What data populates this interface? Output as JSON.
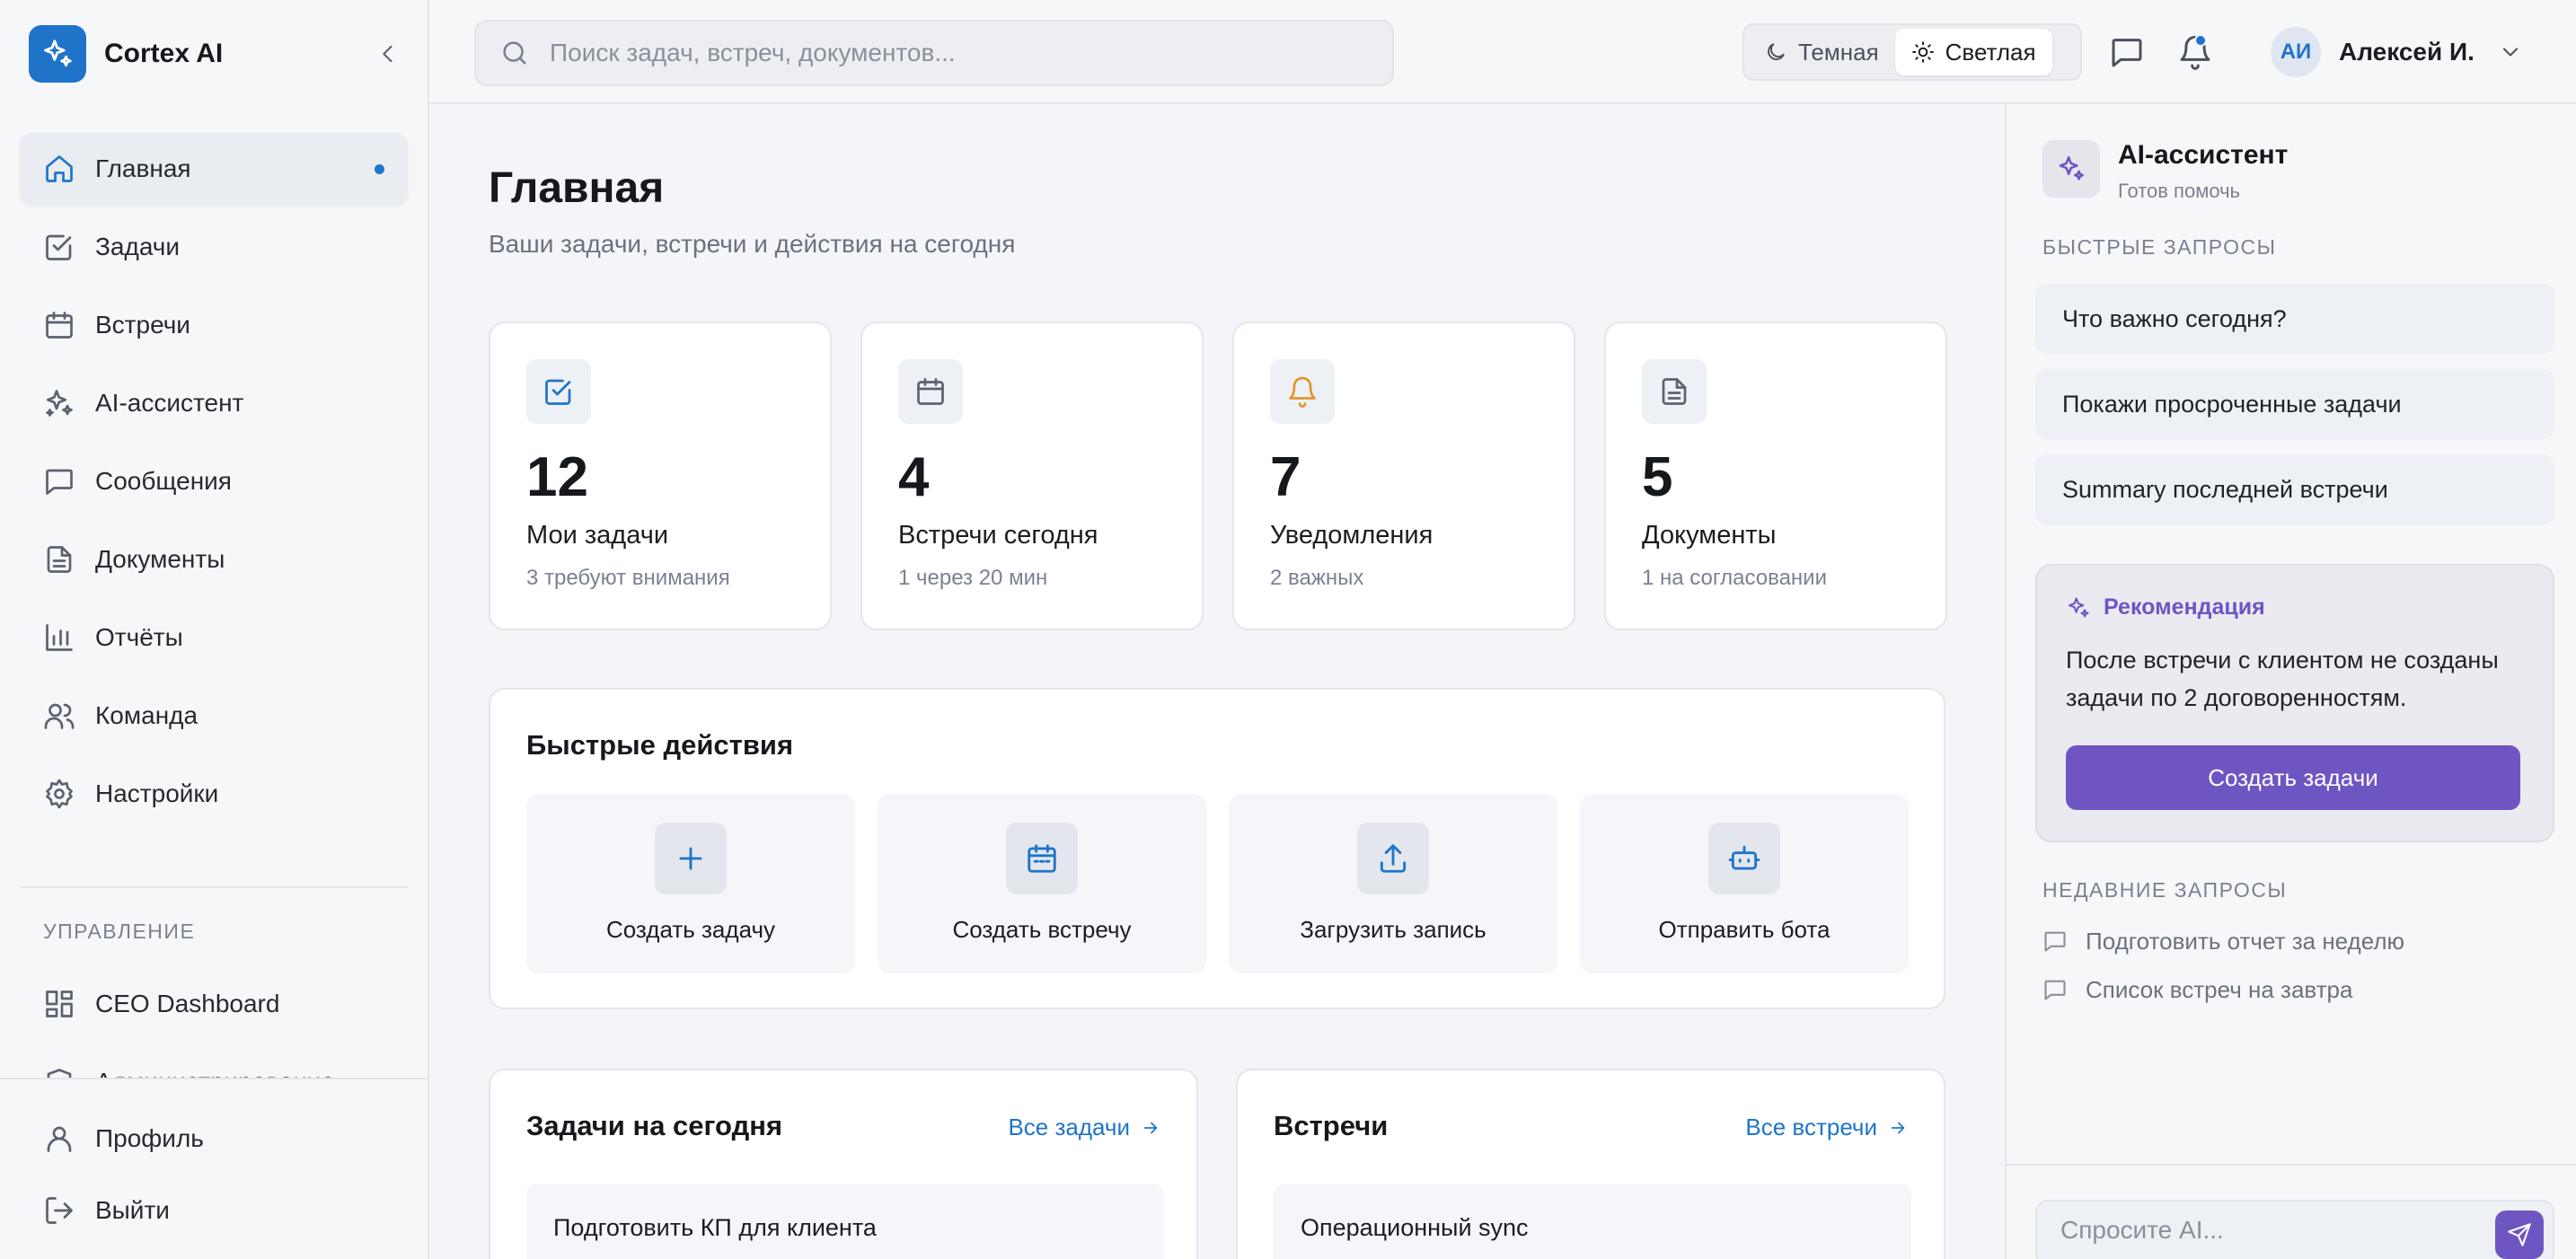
{
  "brand": {
    "name": "Cortex AI"
  },
  "sidebar": {
    "items": [
      {
        "label": "Главная",
        "icon": "home-icon",
        "active": true
      },
      {
        "label": "Задачи",
        "icon": "check-square-icon"
      },
      {
        "label": "Встречи",
        "icon": "calendar-icon"
      },
      {
        "label": "AI-ассистент",
        "icon": "sparkles-icon"
      },
      {
        "label": "Сообщения",
        "icon": "message-icon"
      },
      {
        "label": "Документы",
        "icon": "document-icon"
      },
      {
        "label": "Отчёты",
        "icon": "bar-chart-icon"
      },
      {
        "label": "Команда",
        "icon": "users-icon"
      },
      {
        "label": "Настройки",
        "icon": "gear-icon"
      }
    ],
    "section_label": "УПРАВЛЕНИЕ",
    "manage_items": [
      {
        "label": "CEO Dashboard",
        "icon": "dashboard-icon"
      },
      {
        "label": "Администрирование",
        "icon": "shield-icon"
      }
    ],
    "bottom_items": [
      {
        "label": "Профиль",
        "icon": "user-icon"
      },
      {
        "label": "Выйти",
        "icon": "logout-icon"
      }
    ]
  },
  "topbar": {
    "search_placeholder": "Поиск задач, встреч, документов...",
    "theme_dark": "Темная",
    "theme_light": "Светлая",
    "user_initials": "АИ",
    "user_name": "Алексей И."
  },
  "main": {
    "title": "Главная",
    "subtitle": "Ваши задачи, встречи и действия на сегодня",
    "stats": [
      {
        "value": "12",
        "label": "Мои задачи",
        "sub": "3 требуют внимания",
        "icon": "check-square-icon",
        "icon_color": "#1f74c9"
      },
      {
        "value": "4",
        "label": "Встречи сегодня",
        "sub": "1 через 20 мин",
        "icon": "calendar-icon",
        "icon_color": "#5b6270"
      },
      {
        "value": "7",
        "label": "Уведомления",
        "sub": "2 важных",
        "icon": "bell-icon",
        "icon_color": "#e0962a"
      },
      {
        "value": "5",
        "label": "Документы",
        "sub": "1 на согласовании",
        "icon": "document-icon",
        "icon_color": "#5b6270"
      }
    ],
    "quick_actions": {
      "title": "Быстрые действия",
      "items": [
        {
          "label": "Создать задачу",
          "icon": "plus-icon"
        },
        {
          "label": "Создать встречу",
          "icon": "calendar-icon"
        },
        {
          "label": "Загрузить запись",
          "icon": "upload-icon"
        },
        {
          "label": "Отправить бота",
          "icon": "bot-icon"
        }
      ]
    },
    "tasks": {
      "title": "Задачи на сегодня",
      "link": "Все задачи",
      "first_item": "Подготовить КП для клиента"
    },
    "meetings": {
      "title": "Встречи",
      "link": "Все встречи",
      "first_item": "Операционный sync"
    }
  },
  "assistant": {
    "title": "AI-ассистент",
    "status": "Готов помочь",
    "quick_label": "БЫСТРЫЕ ЗАПРОСЫ",
    "quick_prompts": [
      "Что важно сегодня?",
      "Покажи просроченные задачи",
      "Summary последней встречи"
    ],
    "recommendation": {
      "title": "Рекомендация",
      "text": "После встречи с клиентом не созданы задачи по 2 договоренностям.",
      "button": "Создать задачи"
    },
    "recent_label": "НЕДАВНИЕ ЗАПРОСЫ",
    "recent": [
      "Подготовить отчет за неделю",
      "Список встреч на завтра"
    ],
    "ask_placeholder": "Спросите AI..."
  },
  "colors": {
    "accent": "#1f74c9",
    "ai_purple": "#6f55c2",
    "warning": "#e0962a"
  }
}
